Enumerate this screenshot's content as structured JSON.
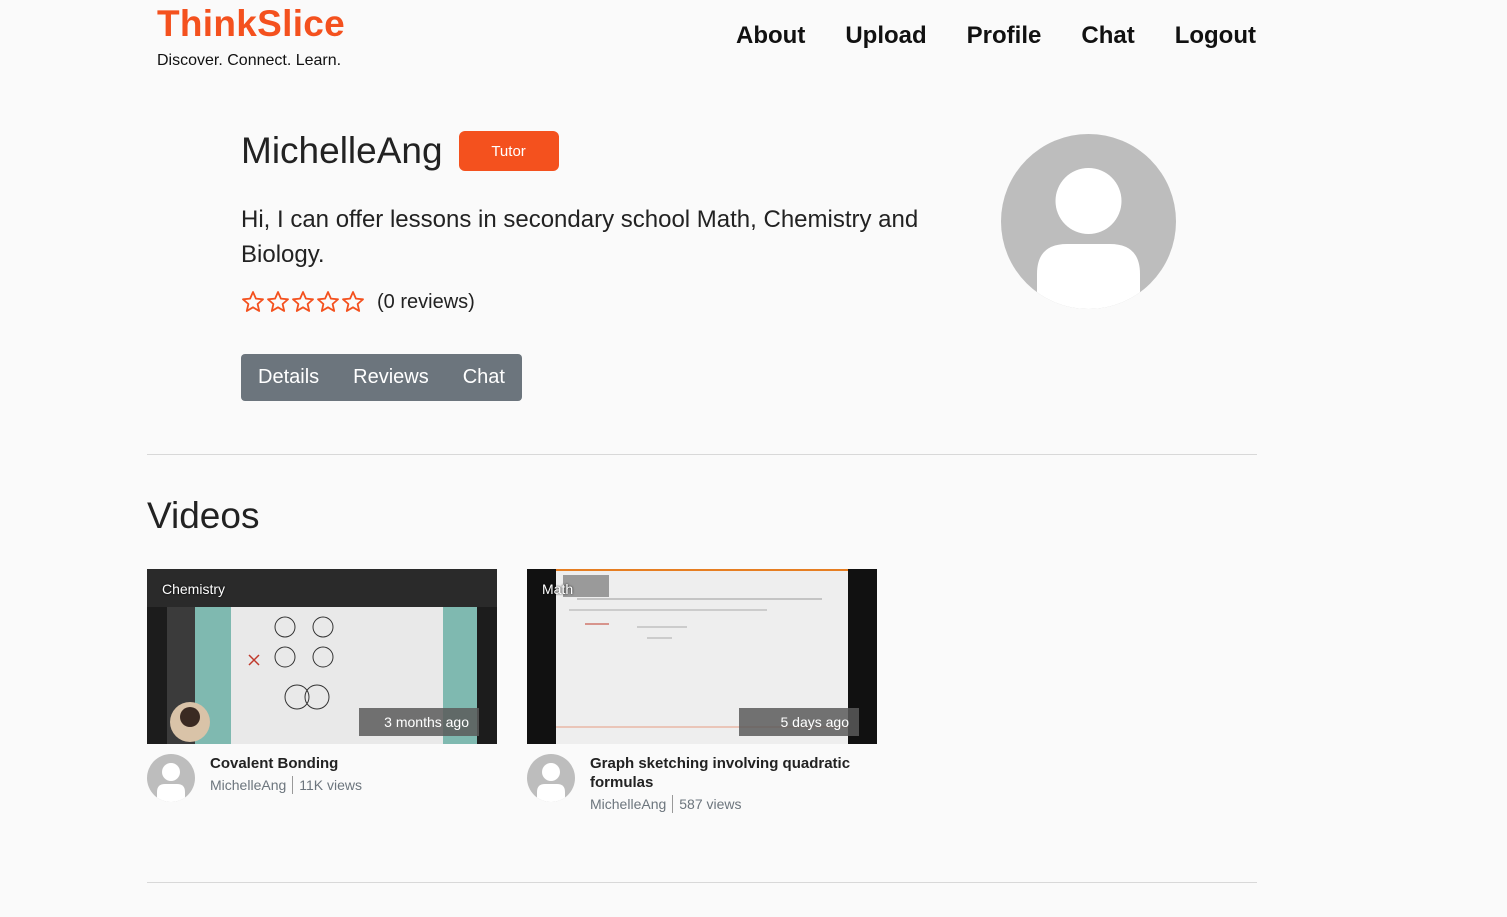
{
  "header": {
    "brand": "ThinkSlice",
    "tagline": "Discover. Connect. Learn.",
    "nav": [
      "About",
      "Upload",
      "Profile",
      "Chat",
      "Logout"
    ]
  },
  "profile": {
    "username": "MichelleAng",
    "role": "Tutor",
    "bio": "Hi, I can offer lessons in secondary school Math, Chemistry and Biology.",
    "rating": 0,
    "max_rating": 5,
    "reviews_label": "(0 reviews)",
    "tabs": [
      "Details",
      "Reviews",
      "Chat"
    ]
  },
  "videos": {
    "heading": "Videos",
    "items": [
      {
        "category": "Chemistry",
        "age": "3 months ago",
        "title": "Covalent Bonding",
        "author": "MichelleAng",
        "views": "11K views"
      },
      {
        "category": "Math",
        "age": "5 days ago",
        "title": "Graph sketching involving quadratic formulas",
        "author": "MichelleAng",
        "views": "587 views"
      }
    ]
  },
  "colors": {
    "accent": "#f4511e",
    "tabs_bg": "#6c757d",
    "avatar": "#bdbdbd"
  }
}
